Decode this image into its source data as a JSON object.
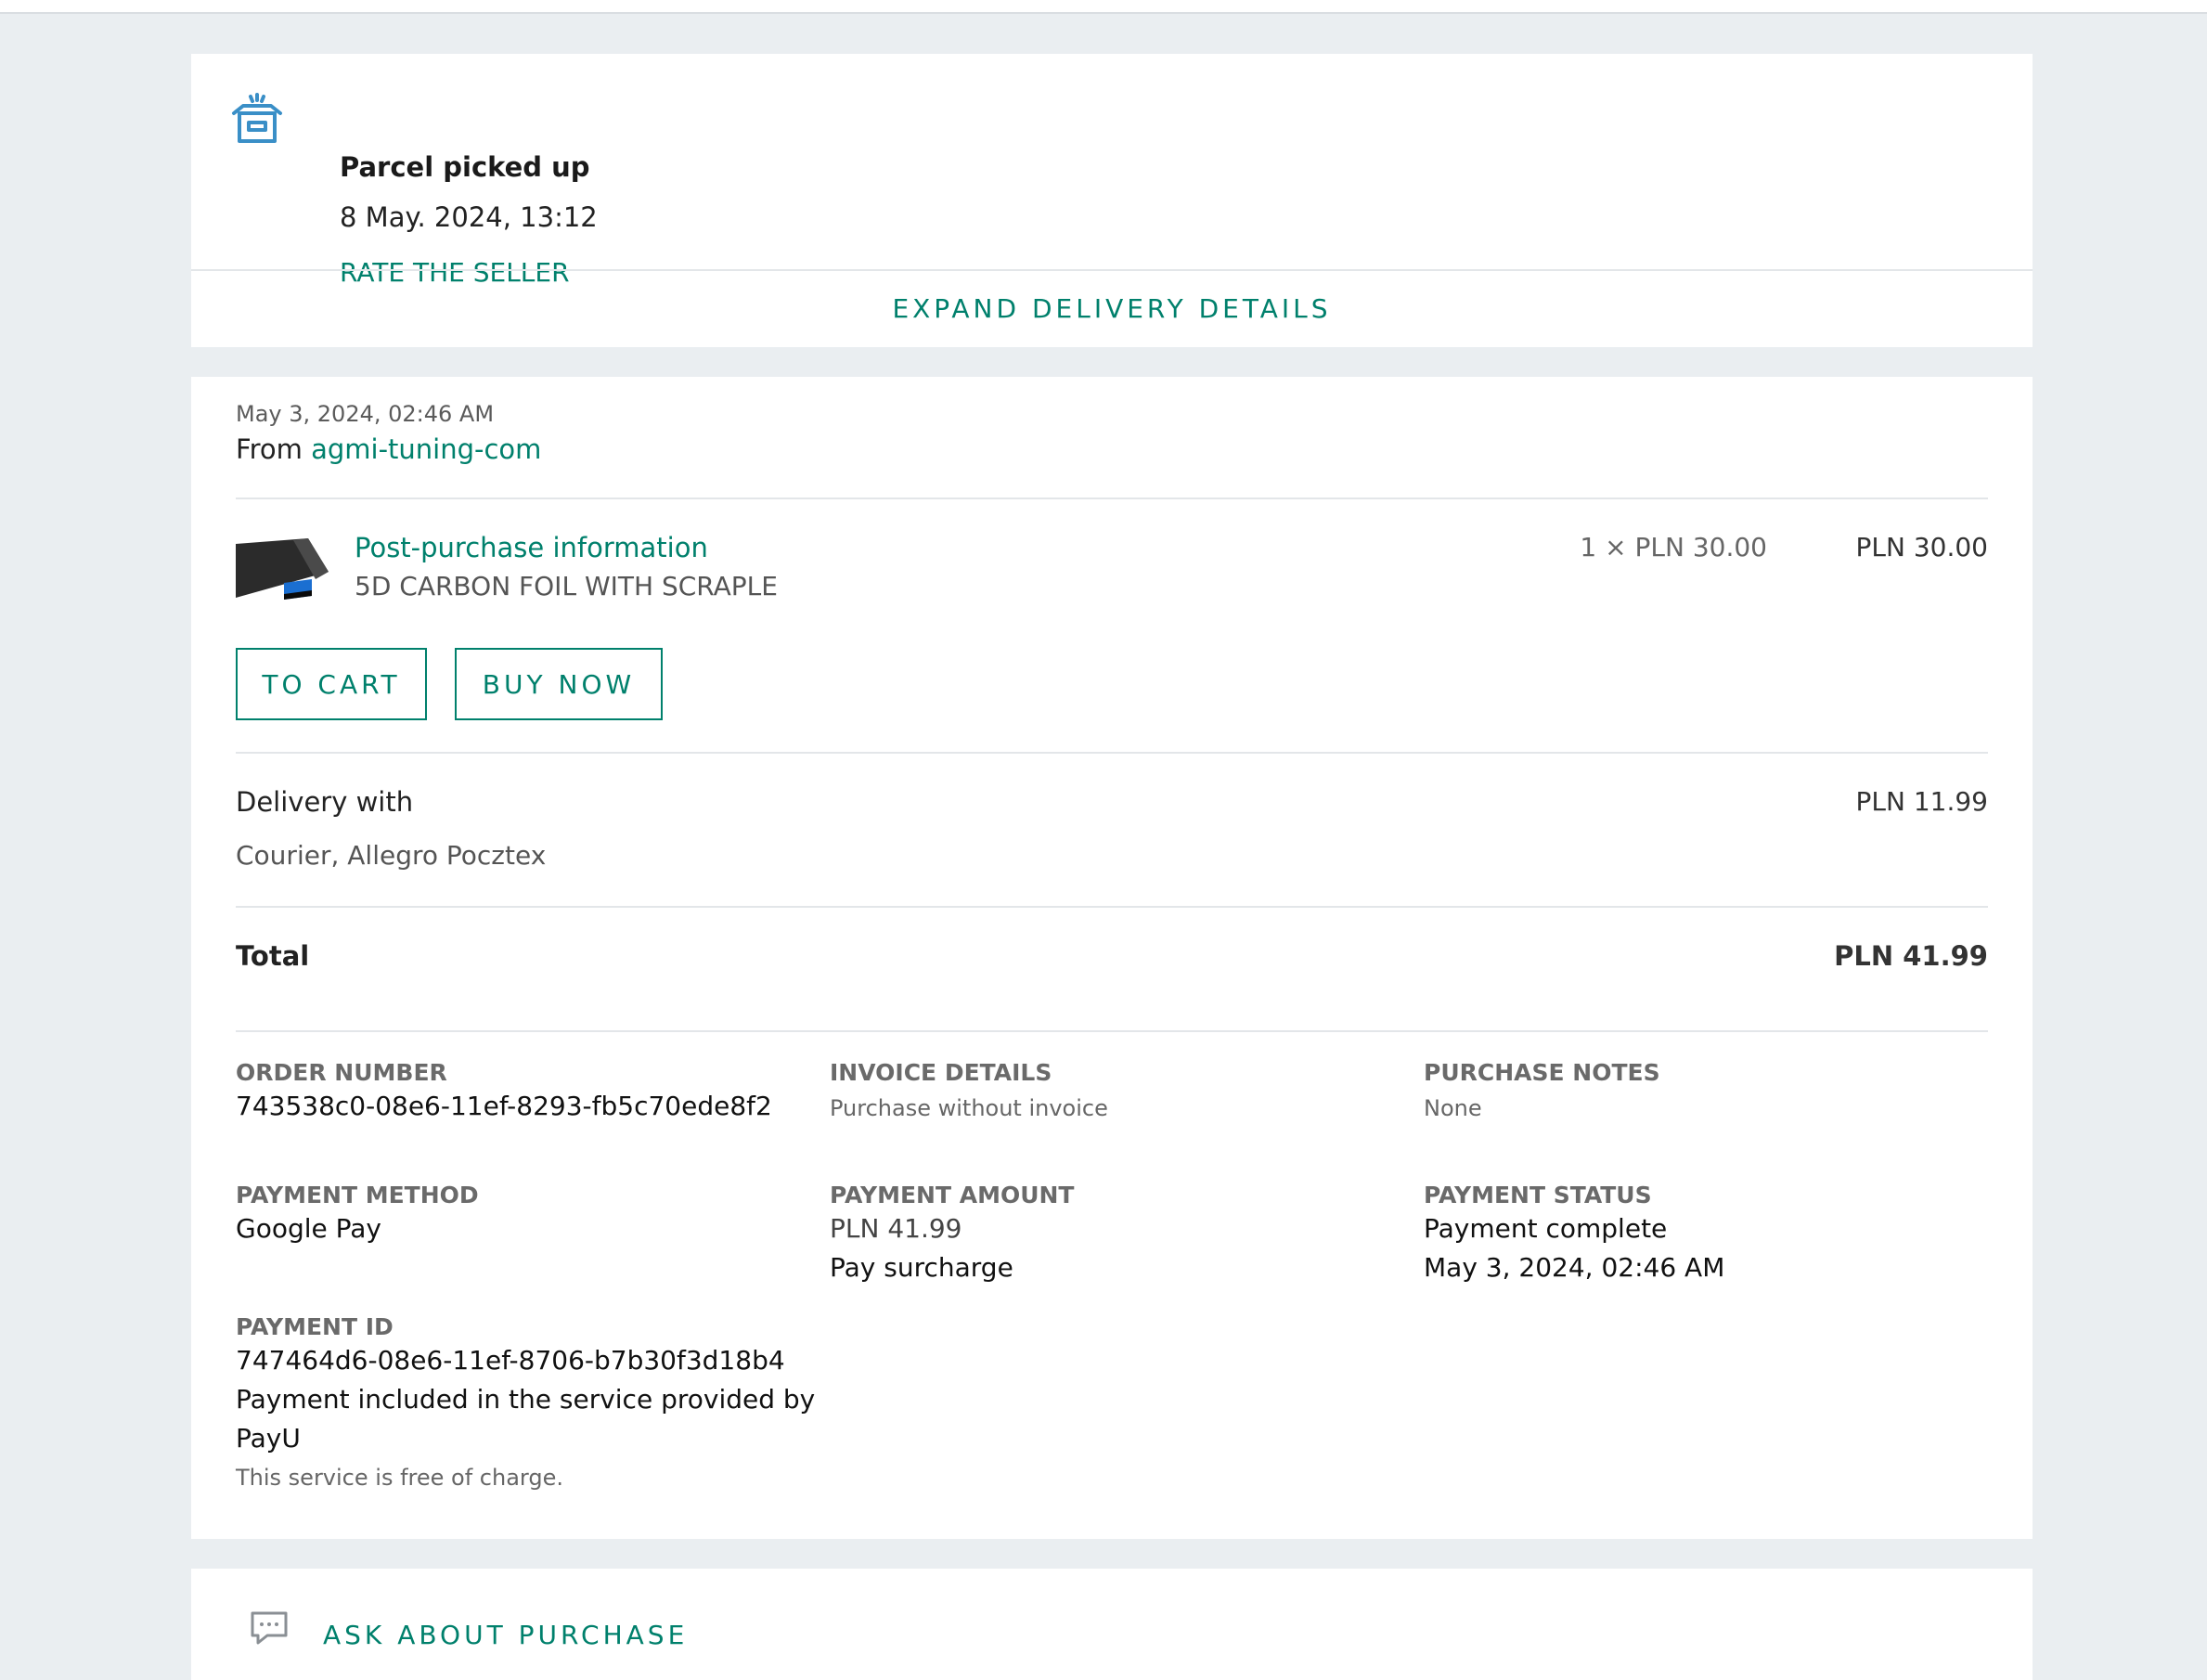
{
  "status_card": {
    "icon": "parcel-box-icon",
    "title": "Parcel picked up",
    "date": "8 May. 2024, 13:12",
    "rate_link": "RATE THE SELLER",
    "expand_link": "EXPAND DELIVERY DETAILS"
  },
  "order": {
    "date": "May 3, 2024, 02:46 AM",
    "from_label": "From",
    "seller": "agmi-tuning-com",
    "product": {
      "link": "Post-purchase information",
      "name": "5D CARBON FOIL WITH SCRAPLE",
      "quantity_price": "1 × PLN 30.00",
      "price": "PLN 30.00"
    },
    "buttons": {
      "to_cart": "TO CART",
      "buy_now": "BUY NOW"
    },
    "delivery": {
      "label": "Delivery with",
      "method": "Courier, Allegro Pocztex",
      "price": "PLN 11.99"
    },
    "total": {
      "label": "Total",
      "value": "PLN 41.99"
    },
    "details": {
      "order_number_label": "ORDER NUMBER",
      "order_number": "743538c0-08e6-11ef-8293-fb5c70ede8f2",
      "invoice_label": "INVOICE DETAILS",
      "invoice": "Purchase without invoice",
      "notes_label": "PURCHASE NOTES",
      "notes": "None",
      "payment_method_label": "PAYMENT METHOD",
      "payment_method": "Google Pay",
      "payment_amount_label": "PAYMENT AMOUNT",
      "payment_amount": "PLN 41.99",
      "pay_surcharge": "Pay surcharge",
      "payment_status_label": "PAYMENT STATUS",
      "payment_status": "Payment complete",
      "payment_status_date": "May 3, 2024, 02:46 AM",
      "payment_id_label": "PAYMENT ID",
      "payment_id": "747464d6-08e6-11ef-8706-b7b30f3d18b4",
      "payu_line1": "Payment included in the service provided by",
      "payu_line2": "PayU",
      "free_note": "This service is free of charge."
    }
  },
  "ask_card": {
    "icon": "chat-bubble-icon",
    "link": "ASK ABOUT PURCHASE"
  },
  "colors": {
    "accent": "#00806c",
    "background": "#eaeef1",
    "icon_blue": "#3a8fc7"
  }
}
